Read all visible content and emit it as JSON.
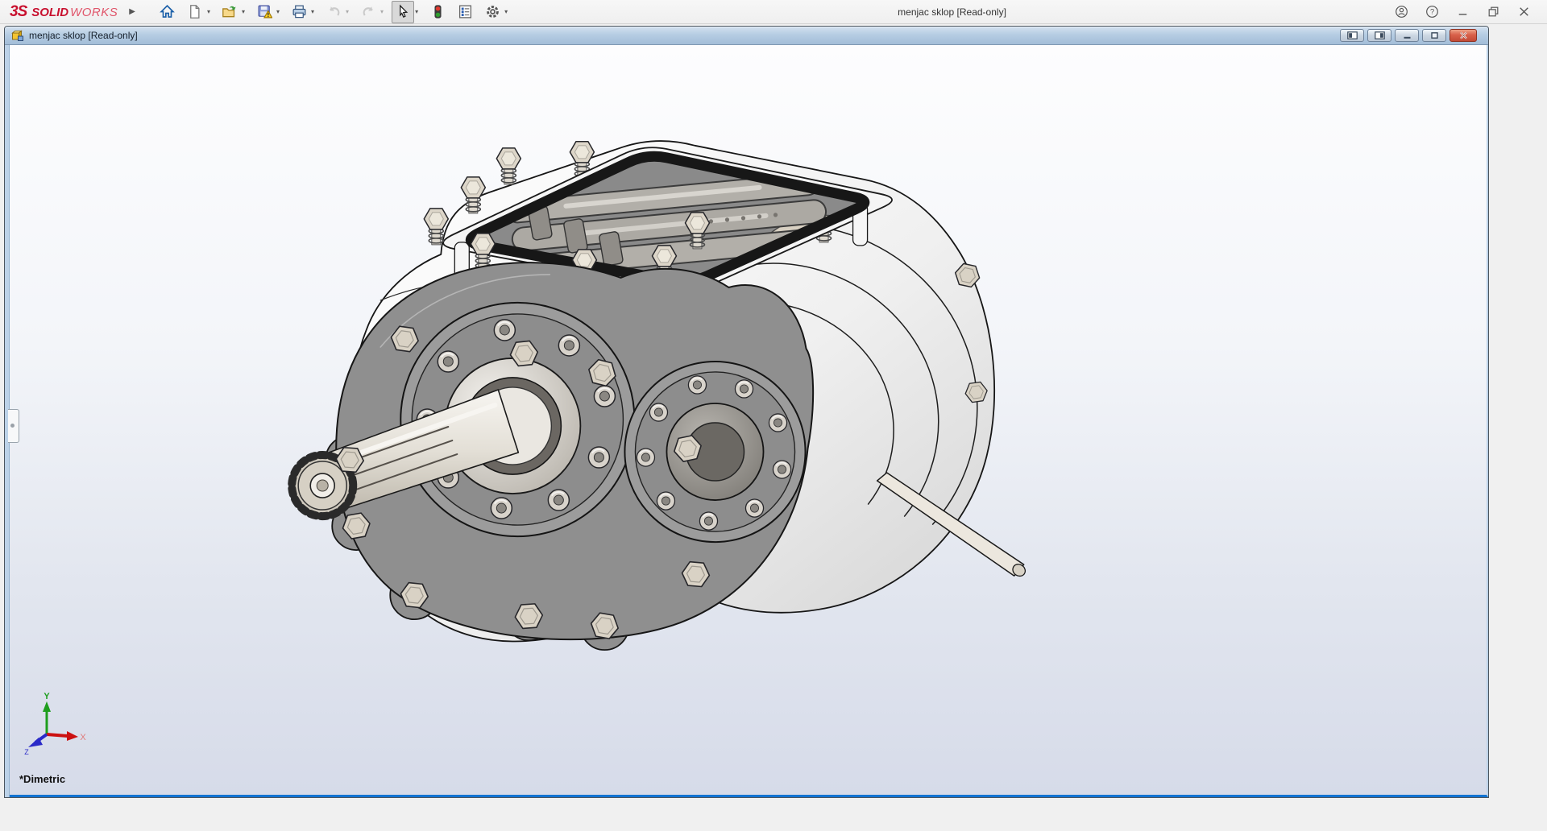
{
  "window": {
    "brand": {
      "mark": "3S",
      "solid": "SOLID",
      "works": "WORKS",
      "color": "#c8102e"
    },
    "title": "menjac sklop [Read-only]",
    "controls": [
      {
        "name": "user-account"
      },
      {
        "name": "help"
      },
      {
        "name": "minimize"
      },
      {
        "name": "restore"
      },
      {
        "name": "close"
      }
    ]
  },
  "toolbar": {
    "items": [
      {
        "name": "home",
        "dropdown": false,
        "state": "normal"
      },
      {
        "name": "new-document",
        "dropdown": true,
        "state": "normal"
      },
      {
        "name": "open",
        "dropdown": true,
        "state": "normal"
      },
      {
        "name": "save",
        "dropdown": true,
        "state": "normal"
      },
      {
        "name": "print",
        "dropdown": true,
        "state": "normal"
      },
      {
        "name": "undo",
        "dropdown": true,
        "state": "disabled"
      },
      {
        "name": "redo",
        "dropdown": true,
        "state": "disabled"
      },
      {
        "name": "select",
        "dropdown": true,
        "state": "pressed"
      },
      {
        "name": "rebuild",
        "dropdown": false,
        "state": "normal"
      },
      {
        "name": "file-properties",
        "dropdown": false,
        "state": "normal"
      },
      {
        "name": "options",
        "dropdown": true,
        "state": "normal"
      }
    ]
  },
  "document_window": {
    "title": "menjac sklop [Read-only]",
    "controls": [
      {
        "name": "tile-left"
      },
      {
        "name": "tile-right"
      },
      {
        "name": "minimize"
      },
      {
        "name": "restore"
      },
      {
        "name": "close"
      }
    ]
  },
  "viewport": {
    "orientation_label": "*Dimetric",
    "triad": {
      "x_label": "X",
      "y_label": "Y",
      "z_label": "Z",
      "x_color": "#e07a7a",
      "y_color": "#1e9e1e",
      "z_color": "#2a2ac8"
    },
    "model_name": "menjac sklop"
  }
}
